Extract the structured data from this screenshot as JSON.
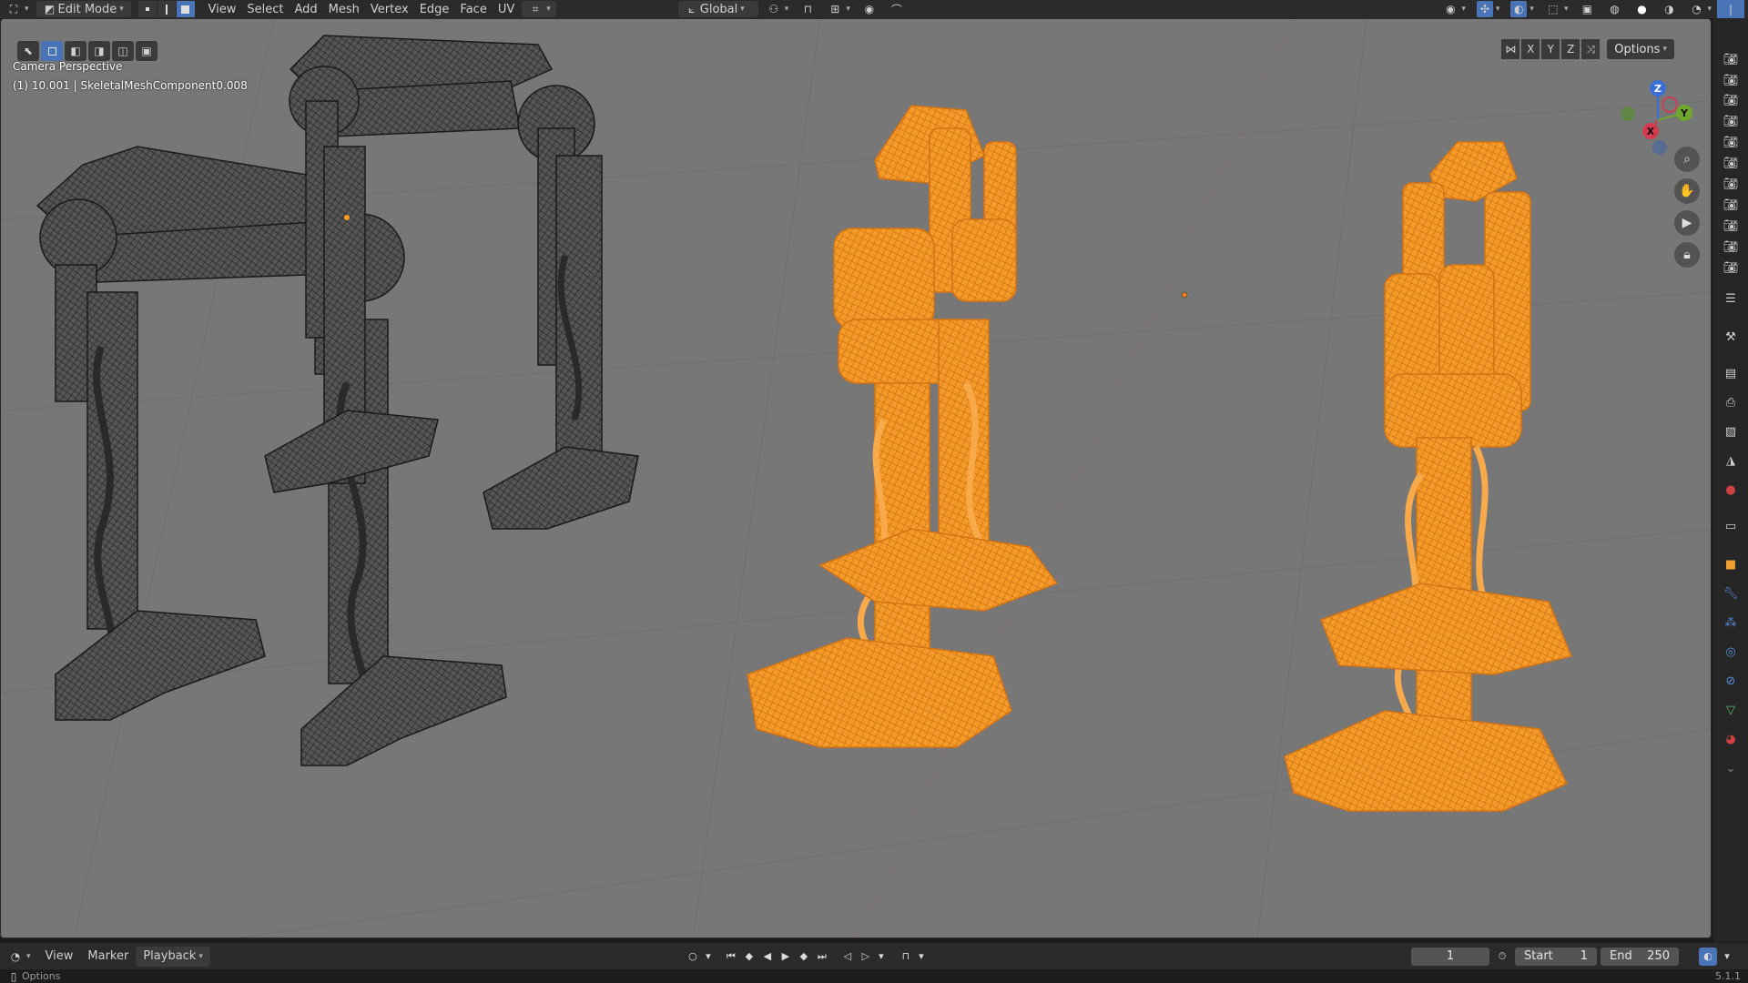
{
  "header": {
    "mode_label": "Edit Mode",
    "menus": [
      "View",
      "Select",
      "Add",
      "Mesh",
      "Vertex",
      "Edge",
      "Face",
      "UV"
    ],
    "transform_orientation": "Global"
  },
  "viewport": {
    "perspective_label": "Camera Perspective",
    "object_label": "(1) 10.001 | SkeletalMeshComponent0.008",
    "axes": {
      "x": "X",
      "y": "Y",
      "z": "Z"
    },
    "options_label": "Options",
    "gizmo": {
      "x": "X",
      "y": "Y",
      "z": "Z"
    }
  },
  "timeline": {
    "menus": [
      "View",
      "Marker",
      "Playback"
    ],
    "current_frame": "1",
    "start_label": "Start",
    "start_value": "1",
    "end_label": "End",
    "end_value": "250"
  },
  "status": {
    "left_label": "Options",
    "version": "5.1.1"
  },
  "colors": {
    "viewport_bg": "#777777",
    "selected_mesh": "#ff9a1f",
    "unselected_mesh": "#2e2e2e",
    "header_bg": "#2b2b2b",
    "active_blue": "#4a74b8"
  }
}
